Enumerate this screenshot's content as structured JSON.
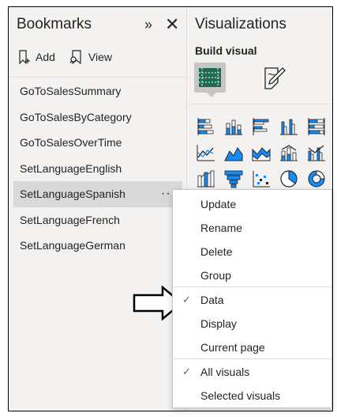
{
  "bookmarks": {
    "title": "Bookmarks",
    "collapse_glyph": "»",
    "close_glyph": "✕",
    "toolbar": {
      "add_label": "Add",
      "view_label": "View"
    },
    "items": [
      {
        "label": "GoToSalesSummary"
      },
      {
        "label": "GoToSalesByCategory"
      },
      {
        "label": "GoToSalesOverTime"
      },
      {
        "label": "SetLanguageEnglish"
      },
      {
        "label": "SetLanguageSpanish",
        "selected": true
      },
      {
        "label": "SetLanguageFrench"
      },
      {
        "label": "SetLanguageGerman"
      }
    ],
    "more_glyph": "···"
  },
  "visualizations": {
    "title": "Visualizations",
    "subtitle": "Build visual",
    "icons": [
      "stacked-bar-chart-icon",
      "stacked-column-chart-icon",
      "clustered-bar-chart-icon",
      "clustered-column-chart-icon",
      "100-stacked-bar-chart-icon",
      "line-chart-icon",
      "area-chart-icon",
      "stacked-area-chart-icon",
      "line-stacked-column-chart-icon",
      "line-clustered-column-chart-icon",
      "ribbon-chart-icon",
      "funnel-chart-icon",
      "scatter-chart-icon",
      "pie-chart-icon",
      "donut-chart-icon"
    ]
  },
  "context_menu": {
    "items": [
      {
        "label": "Update",
        "checked": false
      },
      {
        "label": "Rename",
        "checked": false
      },
      {
        "label": "Delete",
        "checked": false
      },
      {
        "label": "Group",
        "checked": false
      },
      {
        "label": "Data",
        "checked": true
      },
      {
        "label": "Display",
        "checked": false
      },
      {
        "label": "Current page",
        "checked": false
      },
      {
        "label": "All visuals",
        "checked": true
      },
      {
        "label": "Selected visuals",
        "checked": false
      }
    ],
    "check_glyph": "✓"
  },
  "colors": {
    "accent": "#118dff",
    "dark_green": "#1e6b52",
    "selected_bg": "#d9d9d9",
    "pane_bg": "#f3f2f1"
  }
}
